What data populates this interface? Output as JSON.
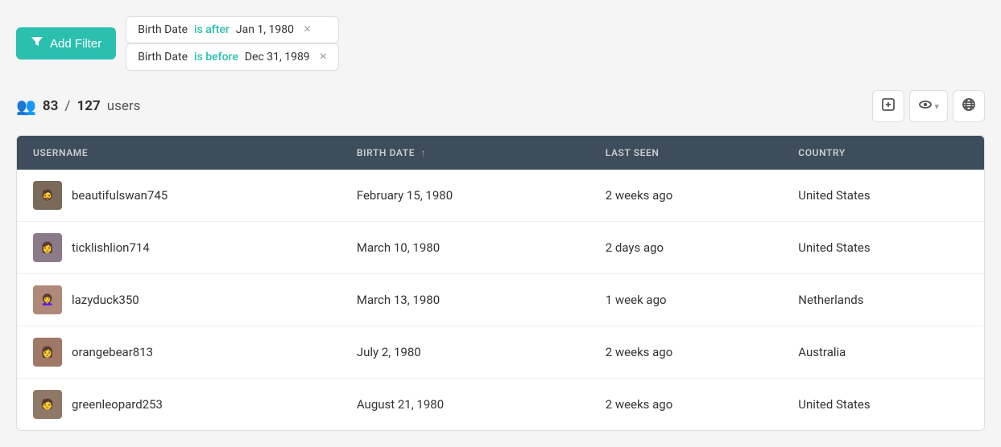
{
  "filters": [
    {
      "id": "filter-after",
      "field": "Birth Date",
      "operator": "is after",
      "value": "Jan 1, 1980"
    },
    {
      "id": "filter-before",
      "field": "Birth Date",
      "operator": "is before",
      "value": "Dec 31, 1989"
    }
  ],
  "addFilter": {
    "label": "Add Filter"
  },
  "summary": {
    "active": "83",
    "total": "127",
    "label": "users"
  },
  "toolbar": {
    "exportIcon": "⊞",
    "visibilityIcon": "👁",
    "globeIcon": "🌐"
  },
  "table": {
    "columns": [
      {
        "key": "username",
        "label": "USERNAME",
        "sortable": false
      },
      {
        "key": "birthdate",
        "label": "BIRTH DATE",
        "sortable": true
      },
      {
        "key": "lastseen",
        "label": "LAST SEEN",
        "sortable": false
      },
      {
        "key": "country",
        "label": "COUNTRY",
        "sortable": false
      }
    ],
    "rows": [
      {
        "username": "beautifulswan745",
        "birthdate": "February 15, 1980",
        "lastseen": "2 weeks ago",
        "country": "United States",
        "avatarClass": "avatar-1",
        "avatarGlyph": "👤"
      },
      {
        "username": "ticklishlion714",
        "birthdate": "March 10, 1980",
        "lastseen": "2 days ago",
        "country": "United States",
        "avatarClass": "avatar-2",
        "avatarGlyph": "👤"
      },
      {
        "username": "lazyduck350",
        "birthdate": "March 13, 1980",
        "lastseen": "1 week ago",
        "country": "Netherlands",
        "avatarClass": "avatar-3",
        "avatarGlyph": "👤"
      },
      {
        "username": "orangebear813",
        "birthdate": "July 2, 1980",
        "lastseen": "2 weeks ago",
        "country": "Australia",
        "avatarClass": "avatar-4",
        "avatarGlyph": "👤"
      },
      {
        "username": "greenleopard253",
        "birthdate": "August 21, 1980",
        "lastseen": "2 weeks ago",
        "country": "United States",
        "avatarClass": "avatar-5",
        "avatarGlyph": "👤"
      }
    ]
  }
}
